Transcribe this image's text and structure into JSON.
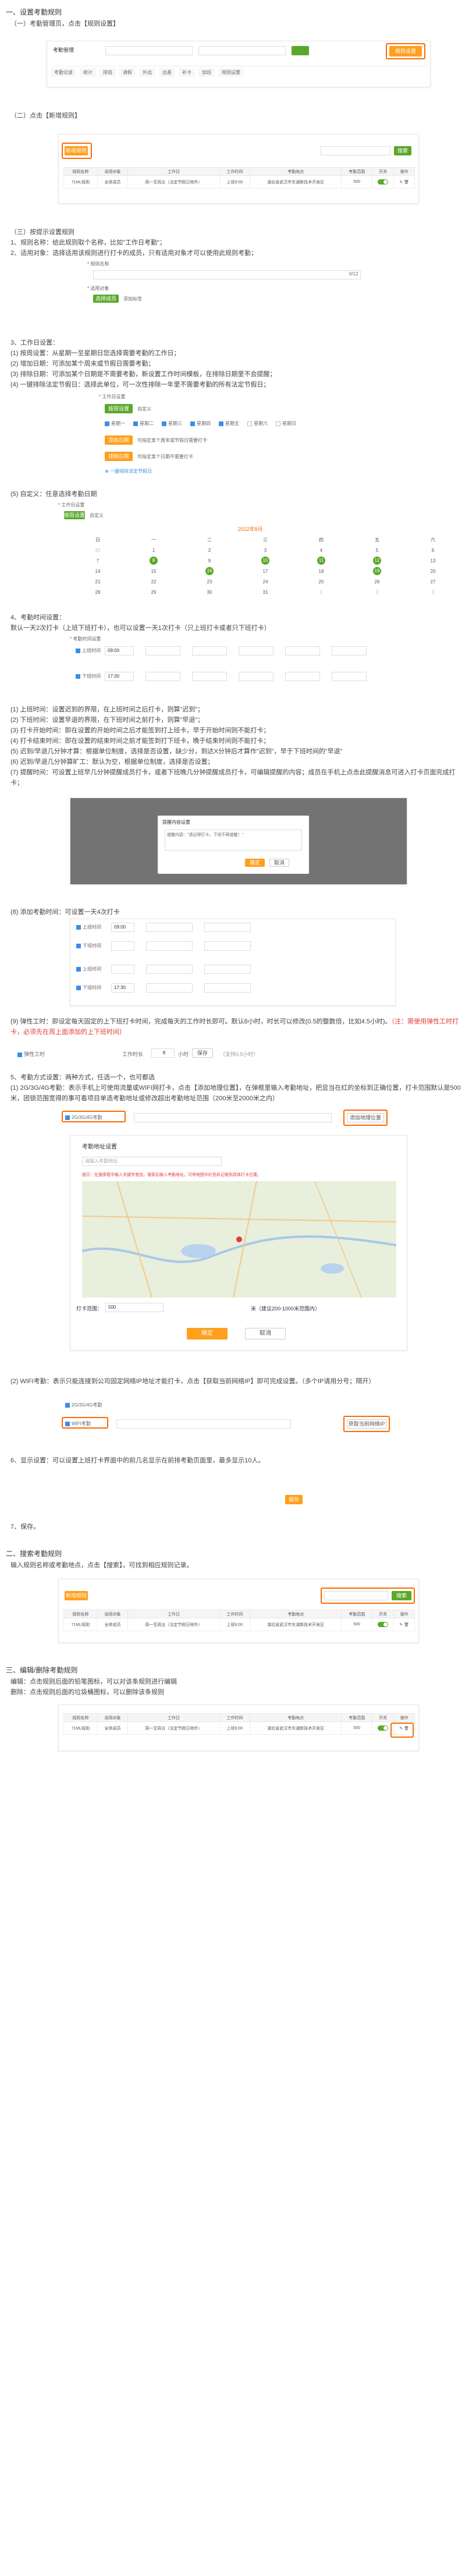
{
  "s1": {
    "title": "一、设置考勤规则",
    "sub1": "（一）考勤管理页，点击【规则设置】",
    "top_btn": "规则设置",
    "sub2": "（二）点击【新增规则】",
    "add_btn": "新增规则",
    "sub3": "（三）按提示设置规则",
    "step1": "1、规则名称：给此规则取个名称，比如\"工作日考勤\"；",
    "step2": "2、适用对象：选择适用该规则进行打卡的成员，只有适用对象才可以使用此规则考勤；",
    "name_label": "* 规则名称",
    "name_count": "0/12",
    "obj_label": "* 适用对象",
    "obj_btn1": "选择成员",
    "obj_btn2": "添加标签"
  },
  "s3": {
    "title": "3、工作日设置：",
    "l1": "(1) 按周设置：从星期一至星期日您选择需要考勤的工作日；",
    "l2": "(2) 增加日期：可添加某个周末或节假日需要考勤；",
    "l3": "(3) 排除日期：可添加某个日期是不需要考勤，新设置工作时间模板，在排除日期里不会提醒；",
    "l4": "(4) 一键排除法定节假日：选择此单位，可一次性排除一年里不需要考勤的所有法定节假日；",
    "wd_label": "* 工作日设置",
    "wd_tab1": "按周设置",
    "wd_tab2": "自定义",
    "days": [
      "星期一",
      "星期二",
      "星期三",
      "星期四",
      "星期五",
      "星期六",
      "星期日"
    ],
    "add_date": "添加日期",
    "add_date_hint": "可指定某个周末或节假日需要打卡",
    "ex_date": "排除日期",
    "ex_date_hint": "可指定某个日期不需要打卡",
    "holiday": "一键排除法定节假日",
    "custom_title": "(5) 自定义：任意选择考勤日期",
    "cal_month": "2022年8月",
    "cal_head": [
      "日",
      "一",
      "二",
      "三",
      "四",
      "五",
      "六"
    ],
    "cal_rows": [
      [
        "31",
        "1",
        "2",
        "3",
        "4",
        "5",
        "6"
      ],
      [
        "7",
        "8",
        "9",
        "10",
        "11",
        "12",
        "13"
      ],
      [
        "14",
        "15",
        "16",
        "17",
        "18",
        "19",
        "20"
      ],
      [
        "21",
        "22",
        "23",
        "24",
        "25",
        "26",
        "27"
      ],
      [
        "28",
        "29",
        "30",
        "31",
        "1",
        "2",
        "3"
      ]
    ]
  },
  "s4": {
    "title": "4、考勤时间设置：",
    "intro": "默认一天2次打卡（上班下班打卡），也可以设置一天1次打卡（只上班打卡或者只下班打卡）",
    "t_label": "* 考勤时间设置",
    "on_label": "上班时间",
    "off_label": "下班时间",
    "on_time": "09:00",
    "off_time": "17:30",
    "l1": "(1) 上班时间：设置迟到的界限，在上班时间之后打卡，则算\"迟到\"；",
    "l2": "(2) 下班时间：设置早退的界限，在下班时间之前打卡，则算\"早退\"；",
    "l3": "(3) 打卡开始时间：即在设置的开始时间之后才能签到打上班卡，早于开始时间则不能打卡；",
    "l4": "(4) 打卡结束时间：即在设置的结束时间之前才能签到打下班卡，晚于结束时间则不能打卡；",
    "l5": "(5) 迟到/早退几分钟才算：根据单位制度，选择是否设置，缺少分，到达X分钟后才算作\"迟到\"，早于下班时间的\"早退\"",
    "l6": "(6) 迟到/早退几分钟算旷工：默认为空，根据单位制度，选择是否设置；",
    "l7": "(7) 提醒时间：可设置上班早几分钟提醒成员打卡，或者下班晚几分钟提醒成员打卡，可编辑提醒的内容；成员在手机上点击此提醒消息可进入打卡页面完成打卡；",
    "dlg_title": "提醒内容设置",
    "dlg_body": "提醒内容：\"请记得打卡，下班不再提醒！\"",
    "dlg_ok": "确定",
    "dlg_cancel": "取消",
    "l8": "(8) 添加考勤时间：可设置一天4次打卡",
    "l9a": "(9) 弹性工时：即设定每天固定的上下班打卡时间，完成每天的工作时长即可。默认8小时，时长可以修改(0.5的整数倍，比如4.5小时)。",
    "l9b": "（注：需使用弹性工时打卡，必须先在周上面添加的上下班时间）",
    "flex_label": "弹性工时",
    "flex_hours_label": "工作时长",
    "flex_hours": "8",
    "flex_unit": "小时",
    "flex_btn": "保存",
    "flex_hint": "（支持0.5小时）"
  },
  "s5": {
    "title": "5、考勤方式设置：两种方式，任选一个，也可都选",
    "l1": "(1) 2G/3G/4G考勤：表示手机上可使用流量或WIFI网打卡，点击【添加地理位置】，在弹框里输入考勤地址，把显当在红的坐标到正确位置，打卡范围默认是500米，团锁范围宽得的事可看项目单选考勤地址或修改超出考勤地址范围（200米至2000米之内）",
    "loc_label": "2G/3G/4G考勤",
    "loc_btn": "添加地理位置",
    "map_title": "考勤地址设置",
    "map_input_ph": "请输入考勤地址",
    "map_tip": "提示：在搜索框中输入关键字查找，搜索后输入考勤地址，可将地图中红色标记拖到具体打卡位置。",
    "range_label": "打卡范围：",
    "range_val": "500",
    "range_hint": "米（建议200-1000米范围内）",
    "map_ok": "确定",
    "map_cancel": "取消",
    "l2": "(2) WIFI考勤：表示只能连接到公司固定网络IP地址才能打卡，点击【获取当前网络IP】即可完成设置。（多个IP请用分号；隔开）",
    "wifi_label": "WIFI考勤",
    "wifi_btn": "获取当前网络IP"
  },
  "s6": {
    "l1": "6、显示设置：可以设置上班打卡界面中的前几名显示在前排考勤页面里，最多显示10人。",
    "save_btn": "保存",
    "l7": "7、保存。"
  },
  "s2": {
    "title": "二、搜索考勤规则",
    "l1": "输入规则名称或考勤地点，点击【搜索】，可找到相应规则记录。",
    "search_btn": "搜索"
  },
  "s3b": {
    "title": "三、编辑/删除考勤规则",
    "l1": "编辑：点击规则后面的铅笔图标，可以对该条规则进行编辑",
    "l2": "删除：点击规则后面的垃圾桶图标，可以删除该条规则"
  },
  "table": {
    "headers": [
      "规则名称",
      "适用对象",
      "工作日",
      "工作时间",
      "考勤地点",
      "考勤范围",
      "开关",
      "操作"
    ],
    "row": [
      "71ML规则",
      "全体成员",
      "周一至周五（法定节假日除外）",
      "上班9:00",
      "湖北省武汉市东湖新技术开发区",
      "500",
      "",
      ""
    ]
  },
  "nav": {
    "title": "考勤管理",
    "tabs": [
      "考勤记录",
      "统计",
      "排班",
      "请假",
      "外出",
      "出差",
      "补卡",
      "加班",
      "规则设置"
    ]
  },
  "colors": {
    "orange": "#ff9f1c",
    "green": "#5aa82b",
    "red": "#e53935",
    "highlight": "#ff6a00"
  }
}
